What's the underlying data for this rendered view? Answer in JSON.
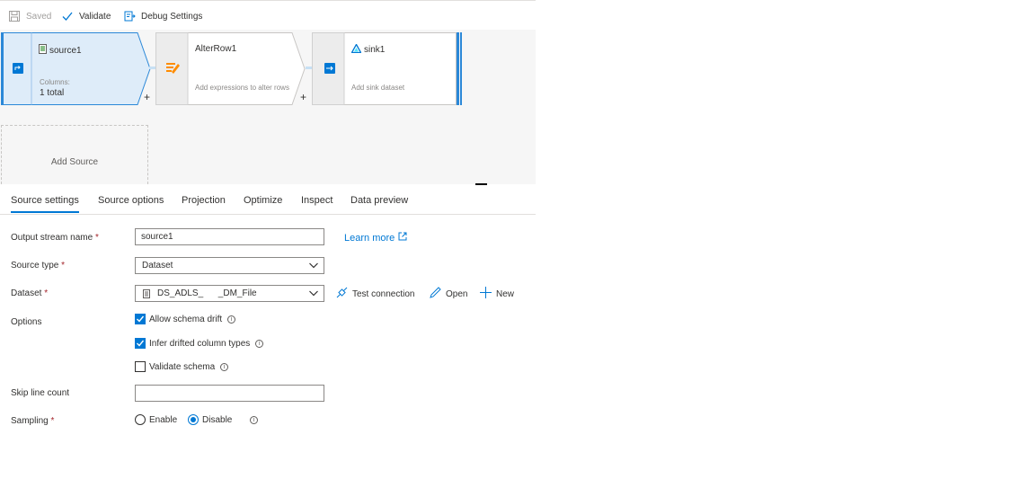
{
  "toolbar": {
    "saved_label": "Saved",
    "validate_label": "Validate",
    "debug_label": "Debug Settings"
  },
  "canvas": {
    "nodes": [
      {
        "title": "source1",
        "sub_label": "Columns:",
        "sub_value": "1 total",
        "icon": "source-doc-icon"
      },
      {
        "title": "AlterRow1",
        "sub_label": "Add expressions to alter rows",
        "icon": "alter-row-icon"
      },
      {
        "title": "sink1",
        "sub_label": "Add sink dataset",
        "icon": "sink-triangle-icon"
      }
    ],
    "add_source_label": "Add Source",
    "plus_symbol": "+"
  },
  "tabs": [
    {
      "label": "Source settings",
      "active": true
    },
    {
      "label": "Source options"
    },
    {
      "label": "Projection"
    },
    {
      "label": "Optimize"
    },
    {
      "label": "Inspect"
    },
    {
      "label": "Data preview"
    }
  ],
  "form": {
    "output_stream": {
      "label": "Output stream name",
      "value": "source1",
      "learn_more": "Learn more"
    },
    "source_type": {
      "label": "Source type",
      "value": "Dataset"
    },
    "dataset": {
      "label": "Dataset",
      "value": "DS_ADLS_      _DM_File",
      "test_connection": "Test connection",
      "open": "Open",
      "new": "New"
    },
    "options": {
      "label": "Options",
      "allow_schema_drift": {
        "label": "Allow schema drift",
        "checked": true
      },
      "infer_drifted": {
        "label": "Infer drifted column types",
        "checked": true
      },
      "validate_schema": {
        "label": "Validate schema",
        "checked": false
      }
    },
    "skip_line_count": {
      "label": "Skip line count",
      "value": ""
    },
    "sampling": {
      "label": "Sampling",
      "enable": "Enable",
      "disable": "Disable",
      "selected": "Disable"
    },
    "required_mark": "*"
  },
  "colors": {
    "accent": "#0078d4",
    "required": "#a4262c",
    "selected_node": "#deecf9"
  }
}
